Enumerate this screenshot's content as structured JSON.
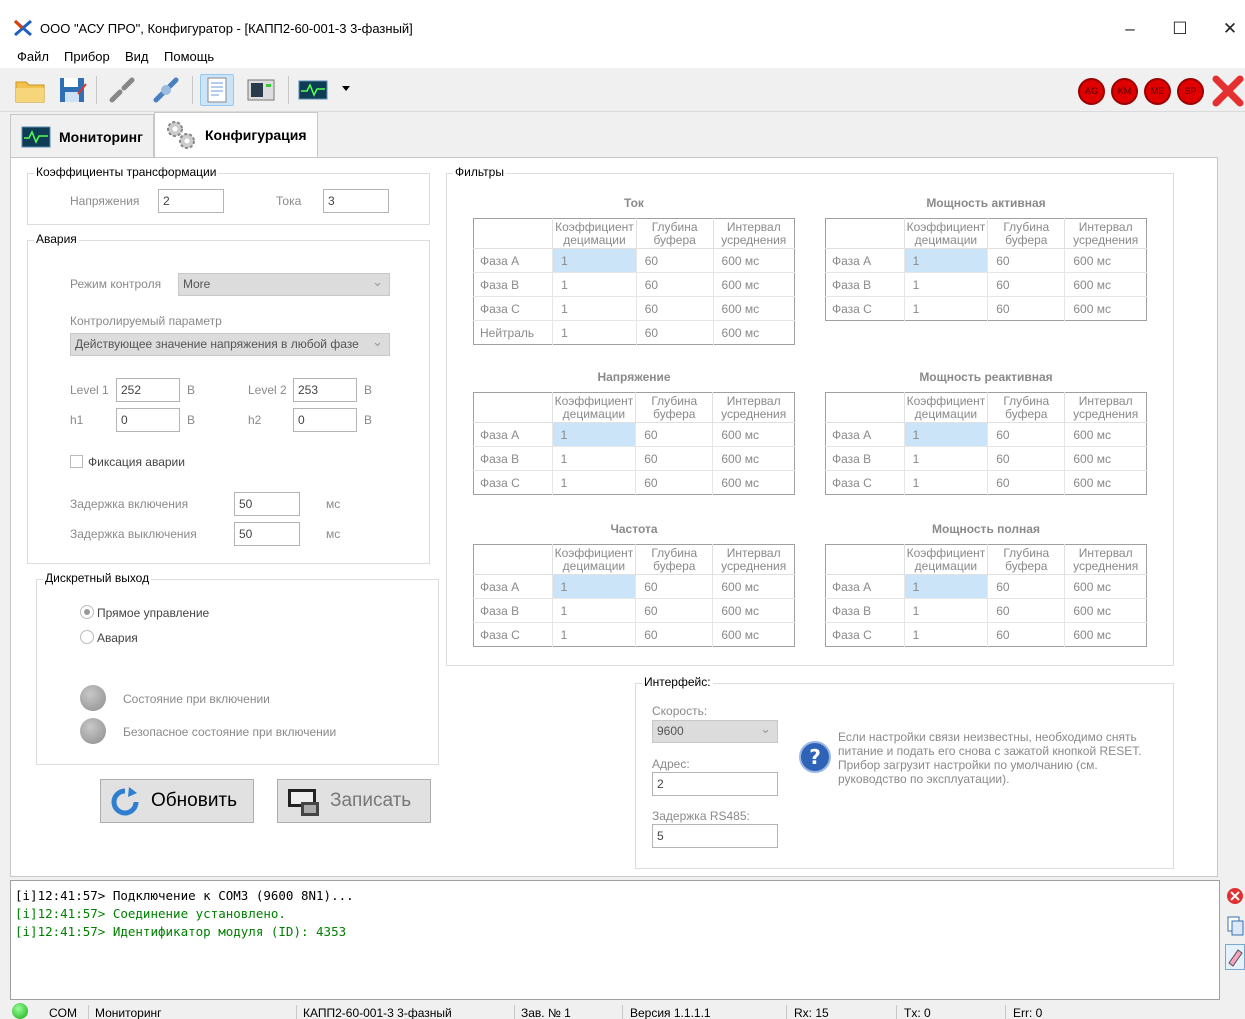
{
  "window": {
    "title": "ООО \"АСУ ПРО\", Конфигуратор - [КАПП2-60-001-3 3-фазный]",
    "minimize": "–",
    "maximize": "☐",
    "close": "✕"
  },
  "menu": [
    "Файл",
    "Прибор",
    "Вид",
    "Помощь"
  ],
  "toolbar": {
    "indicators": [
      "AG",
      "KM",
      "ME",
      "SP"
    ]
  },
  "tabs": {
    "monitoring": "Мониторинг",
    "config": "Конфигурация"
  },
  "transform": {
    "title": "Коэффициенты трансформации",
    "voltage_label": "Напряжения",
    "voltage_value": "2",
    "current_label": "Тока",
    "current_value": "3"
  },
  "alarm": {
    "title": "Авария",
    "mode_label": "Режим контроля",
    "mode_value": "More",
    "param_label": "Контролируемый параметр",
    "param_value": "Действующее значение напряжения в любой фазе",
    "level1_label": "Level 1",
    "level1_value": "252",
    "level2_label": "Level 2",
    "level2_value": "253",
    "h1_label": "h1",
    "h1_value": "0",
    "h2_label": "h2",
    "h2_value": "0",
    "unit_v": "В",
    "fix_label": "Фиксация аварии",
    "on_delay_label": "Задержка включения",
    "on_delay_value": "50",
    "off_delay_label": "Задержка выключения",
    "off_delay_value": "50",
    "unit_ms": "мс"
  },
  "discrete": {
    "title": "Дискретный выход",
    "direct_label": "Прямое управление",
    "alarm_label": "Авария",
    "state_on_label": "Состояние при включении",
    "safe_state_label": "Безопасное состояние при включении"
  },
  "buttons": {
    "refresh": "Обновить",
    "write": "Записать"
  },
  "filters": {
    "title": "Фильтры",
    "col_headers": {
      "decimation_1": "Коэффициент",
      "decimation_2": "децимации",
      "depth_1": "Глубина",
      "depth_2": "буфера",
      "interval_1": "Интервал",
      "interval_2": "усреднения"
    },
    "tables": [
      {
        "title": "Ток",
        "rows": [
          [
            "Фаза A",
            "1",
            "60",
            "600 мс"
          ],
          [
            "Фаза B",
            "1",
            "60",
            "600 мс"
          ],
          [
            "Фаза C",
            "1",
            "60",
            "600 мс"
          ],
          [
            "Нейтраль",
            "1",
            "60",
            "600 мс"
          ]
        ]
      },
      {
        "title": "Мощность активная",
        "rows": [
          [
            "Фаза A",
            "1",
            "60",
            "600 мс"
          ],
          [
            "Фаза B",
            "1",
            "60",
            "600 мс"
          ],
          [
            "Фаза C",
            "1",
            "60",
            "600 мс"
          ]
        ]
      },
      {
        "title": "Напряжение",
        "rows": [
          [
            "Фаза A",
            "1",
            "60",
            "600 мс"
          ],
          [
            "Фаза B",
            "1",
            "60",
            "600 мс"
          ],
          [
            "Фаза C",
            "1",
            "60",
            "600 мс"
          ]
        ]
      },
      {
        "title": "Мощность реактивная",
        "rows": [
          [
            "Фаза A",
            "1",
            "60",
            "600 мс"
          ],
          [
            "Фаза B",
            "1",
            "60",
            "600 мс"
          ],
          [
            "Фаза C",
            "1",
            "60",
            "600 мс"
          ]
        ]
      },
      {
        "title": "Частота",
        "rows": [
          [
            "Фаза A",
            "1",
            "60",
            "600 мс"
          ],
          [
            "Фаза B",
            "1",
            "60",
            "600 мс"
          ],
          [
            "Фаза C",
            "1",
            "60",
            "600 мс"
          ]
        ]
      },
      {
        "title": "Мощность полная",
        "rows": [
          [
            "Фаза A",
            "1",
            "60",
            "600 мс"
          ],
          [
            "Фаза B",
            "1",
            "60",
            "600 мс"
          ],
          [
            "Фаза C",
            "1",
            "60",
            "600 мс"
          ]
        ]
      }
    ]
  },
  "interface": {
    "title": "Интерфейс:",
    "speed_label": "Скорость:",
    "speed_value": "9600",
    "address_label": "Адрес:",
    "address_value": "2",
    "delay_label": "Задержка RS485:",
    "delay_value": "5",
    "help_text": "Если настройки связи неизвестны, необходимо снять питание и подать его снова с зажатой кнопкой RESET. Прибор загрузит настройки по умолчанию (см. руководство по эксплуатации)."
  },
  "log": [
    "[i]12:41:57> Подключение к COM3 (9600 8N1)...",
    "[i]12:41:57> Соединение установлено.",
    "[i]12:41:57> Идентификатор модуля (ID): 4353"
  ],
  "statusbar": {
    "port": "COM",
    "mode": "Мониторинг",
    "device": "КАПП2-60-001-3 3-фазный",
    "serial": "Зав. № 1",
    "version": "Версия 1.1.1.1",
    "rx": "Rx: 15",
    "tx": "Tx: 0",
    "err": "Err: 0"
  },
  "colors": {
    "accent": "#cce4f7",
    "log_info": "#000000",
    "log_ok": "#008000",
    "indicator": "#e00000"
  }
}
